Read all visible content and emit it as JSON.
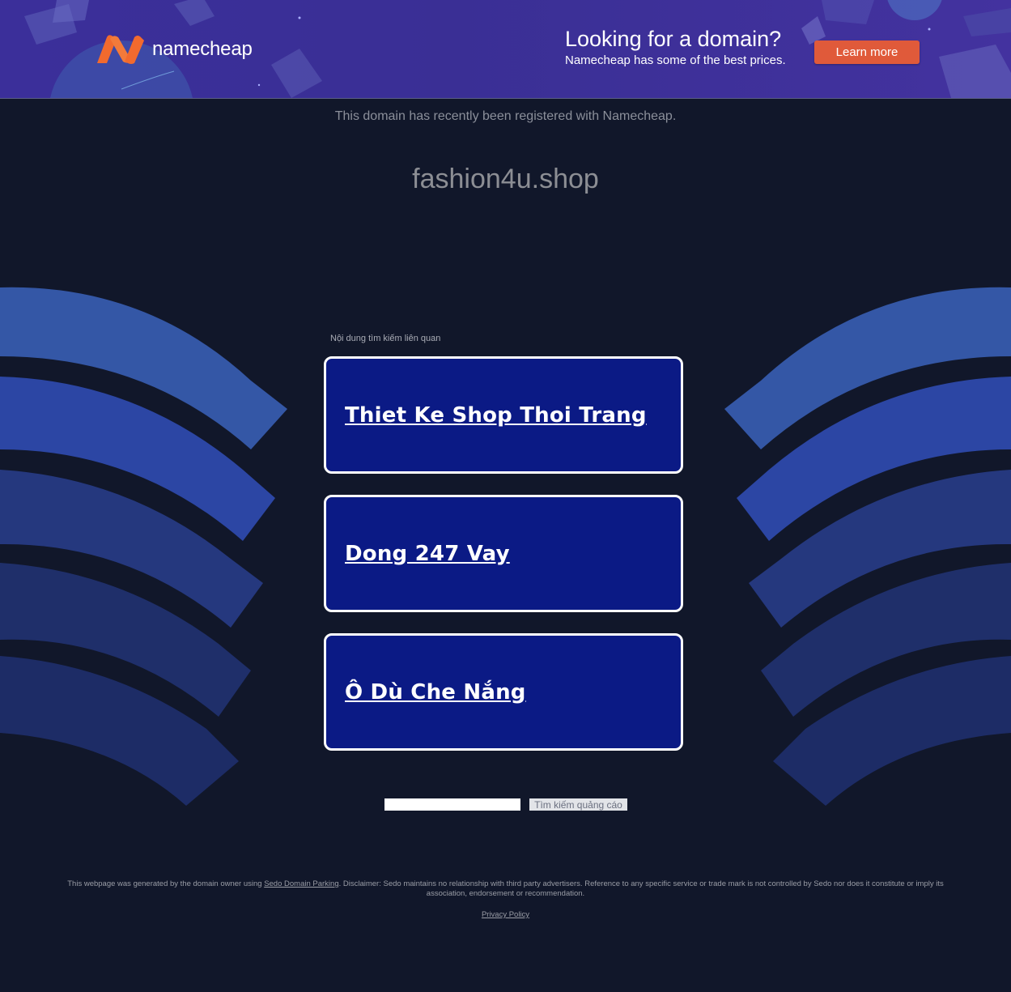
{
  "banner": {
    "logo_text": "namecheap",
    "promo_title": "Looking for a domain?",
    "promo_subtitle": "Namecheap has some of the best prices.",
    "cta_label": "Learn more",
    "accent": "#e05a3a",
    "background": "#3b2f9a"
  },
  "main": {
    "registered_text": "This domain has recently been registered with Namecheap.",
    "domain": "fashion4u.shop",
    "related_label": "Nội dung tìm kiếm liên quan",
    "ads": [
      {
        "label": "Thiet Ke Shop Thoi Trang"
      },
      {
        "label": "Dong 247 Vay"
      },
      {
        "label": "Ô Dù Che Nắng"
      }
    ],
    "card_color": "#0b1a85",
    "search_input_value": "",
    "search_button_label": "Tìm kiếm quảng cáo"
  },
  "footer": {
    "disclaimer_prefix": "This webpage was generated by the domain owner using",
    "sedo_link": "Sedo Domain Parking",
    "disclaimer_suffix": ". Disclaimer: Sedo maintains no relationship with third party advertisers. Reference to any specific service or trade mark is not controlled by Sedo nor does it constitute or imply its association, endorsement or recommendation.",
    "privacy_link": "Privacy Policy"
  }
}
